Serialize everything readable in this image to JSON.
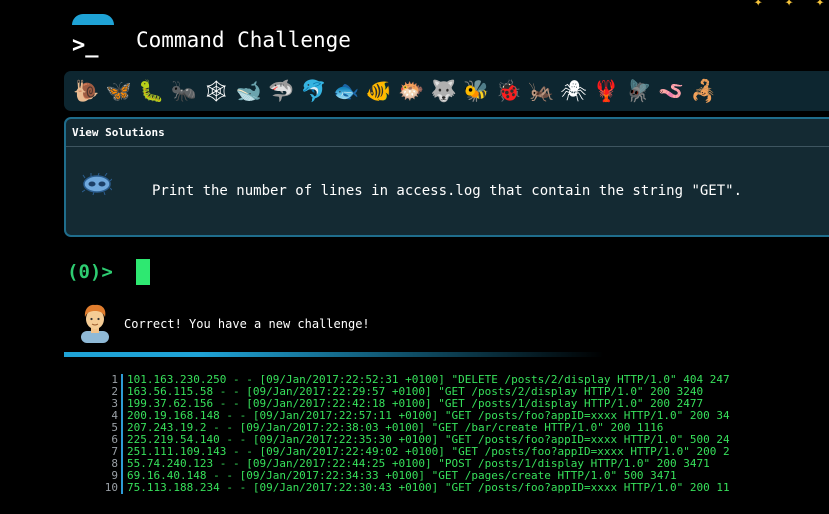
{
  "header": {
    "title": "Command Challenge",
    "logo_icon": "terminal-icon",
    "logo_color": "#1fa3d6"
  },
  "top_decoration": [
    "✦",
    "✦",
    "✦"
  ],
  "creatures": [
    {
      "glyph": "🐌",
      "name": "snail"
    },
    {
      "glyph": "🦋",
      "name": "butterfly"
    },
    {
      "glyph": "🐛",
      "name": "caterpillar"
    },
    {
      "glyph": "🐜",
      "name": "ant"
    },
    {
      "glyph": "🕸",
      "name": "spiderweb"
    },
    {
      "glyph": "🐋",
      "name": "whale"
    },
    {
      "glyph": "🦈",
      "name": "shark"
    },
    {
      "glyph": "🐬",
      "name": "dolphin"
    },
    {
      "glyph": "🐟",
      "name": "fish"
    },
    {
      "glyph": "🐠",
      "name": "tropical-fish"
    },
    {
      "glyph": "🐡",
      "name": "blowfish"
    },
    {
      "glyph": "🐺",
      "name": "wolf"
    },
    {
      "glyph": "🐝",
      "name": "bee"
    },
    {
      "glyph": "🐞",
      "name": "ladybug"
    },
    {
      "glyph": "🦗",
      "name": "cricket"
    },
    {
      "glyph": "🕷",
      "name": "spider"
    },
    {
      "glyph": "🦞",
      "name": "lobster"
    },
    {
      "glyph": "🪰",
      "name": "fly"
    },
    {
      "glyph": "🪱",
      "name": "worm"
    },
    {
      "glyph": "🦂",
      "name": "scorpion"
    }
  ],
  "challenge": {
    "view_solutions_label": "View Solutions",
    "icon": "microbe-icon",
    "text": "Print the number of lines in access.log that contain the string \"GET\"."
  },
  "terminal": {
    "prompt": "(0)>"
  },
  "feedback": {
    "avatar_icon": "person-avatar-icon",
    "message": "Correct! You have a new challenge!"
  },
  "log_lines": [
    {
      "n": "1",
      "text": "101.163.230.250 - - [09/Jan/2017:22:52:31 +0100] \"DELETE /posts/2/display HTTP/1.0\" 404 247"
    },
    {
      "n": "2",
      "text": "163.56.115.58 - - [09/Jan/2017:22:29:57 +0100] \"GET /posts/2/display HTTP/1.0\" 200 3240"
    },
    {
      "n": "3",
      "text": "199.37.62.156 - - [09/Jan/2017:22:42:18 +0100] \"GET /posts/1/display HTTP/1.0\" 200 2477"
    },
    {
      "n": "4",
      "text": "200.19.168.148 - - [09/Jan/2017:22:57:11 +0100] \"GET /posts/foo?appID=xxxx HTTP/1.0\" 200 34"
    },
    {
      "n": "5",
      "text": "207.243.19.2 - - [09/Jan/2017:22:38:03 +0100] \"GET /bar/create HTTP/1.0\" 200 1116"
    },
    {
      "n": "6",
      "text": "225.219.54.140 - - [09/Jan/2017:22:35:30 +0100] \"GET /posts/foo?appID=xxxx HTTP/1.0\" 500 24"
    },
    {
      "n": "7",
      "text": "251.111.109.143 - - [09/Jan/2017:22:49:02 +0100] \"GET /posts/foo?appID=xxxx HTTP/1.0\" 200 2"
    },
    {
      "n": "8",
      "text": "55.74.240.123 - - [09/Jan/2017:22:44:25 +0100] \"POST /posts/1/display HTTP/1.0\" 200 3471"
    },
    {
      "n": "9",
      "text": "69.16.40.148 - - [09/Jan/2017:22:34:33 +0100] \"GET /pages/create HTTP/1.0\" 500 3471"
    },
    {
      "n": "10",
      "text": "75.113.188.234 - - [09/Jan/2017:22:30:43 +0100] \"GET /posts/foo?appID=xxxx HTTP/1.0\" 200 11"
    }
  ]
}
